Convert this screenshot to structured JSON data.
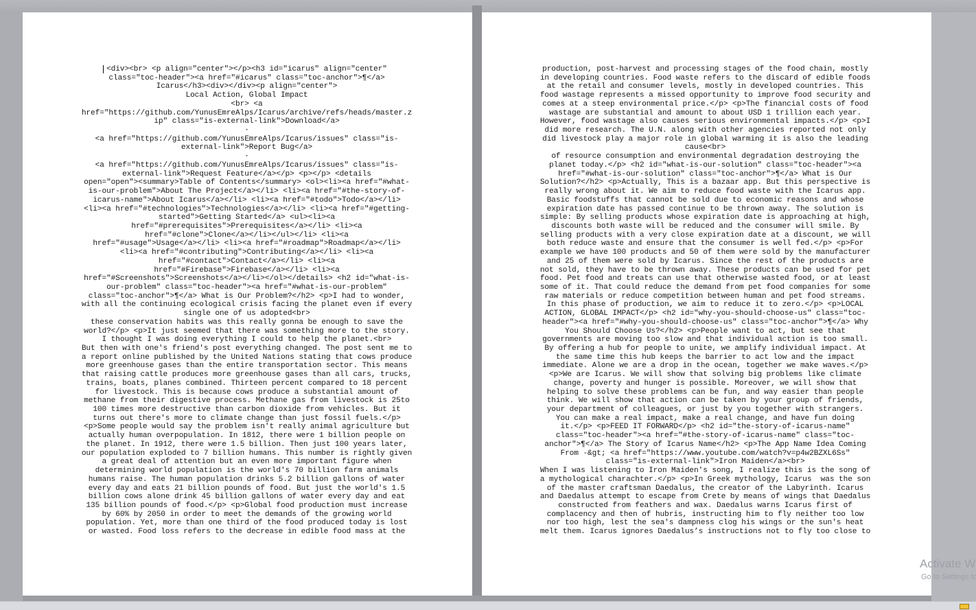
{
  "document": {
    "left_page": {
      "lines": [
        "<div><br> <p align=\"center\"></p><h3 id=\"icarus\" align=\"center\"",
        "class=\"toc-header\"><a href=\"#icarus\" class=\"toc-anchor\">¶</a>",
        "Icarus</h3><div></div><p align=\"center\">",
        "Local Action, Global Impact",
        "<br> <a",
        "href=\"https://github.com/YunusEmreAlps/Icarus/archive/refs/heads/master.z",
        "ip\" class=\"is-external-link\">Download</a>",
        "·",
        "<a href=\"https://github.com/YunusEmreAlps/Icarus/issues\" class=\"is-",
        "external-link\">Report Bug</a>",
        "·",
        "<a href=\"https://github.com/YunusEmreAlps/Icarus/issues\" class=\"is-",
        "external-link\">Request Feature</a></p> <p></p> <details",
        "open=\"open\"><summary>Table of Contents</summary> <ol><li><a href=\"#what-",
        "is-our-problem\">About The Project</a></li> <li><a href=\"#the-story-of-",
        "icarus-name\">About Icarus</a></li> <li><a href=\"#todo\">Todo</a></li>",
        "<li><a href=\"#technologies\">Technologies</a></li> <li><a href=\"#getting-",
        "started\">Getting Started</a> <ul><li><a",
        "href=\"#prerequisites\">Prerequisites</a></li> <li><a",
        "href=\"#clone\">Clone</a></li></ul></li> <li><a",
        "href=\"#usage\">Usage</a></li> <li><a href=\"#roadmap\">Roadmap</a></li>",
        "<li><a href=\"#contributing\">Contributing</a></li> <li><a",
        "href=\"#contact\">Contact</a></li> <li><a",
        "href=\"#Firebase\">Firebase</a></li> <li><a",
        "href=\"#Screenshots\">Screenshots</a></li></ol></details> <h2 id=\"what-is-",
        "our-problem\" class=\"toc-header\"><a href=\"#what-is-our-problem\"",
        "class=\"toc-anchor\">¶</a> What is Our Problem?</h2> <p>I had to wonder,",
        "with all the continuing ecological crisis facing the planet even if every",
        "single one of us adopted<br>",
        "these conservation habits was this really gonna be enough to save the",
        "world?</p> <p>It just seemed that there was something more to the story.",
        "I thought I was doing everything I could to help the planet.<br>",
        "But then with one's friend's post everything changed. The post sent me to",
        "a report online published by the United Nations stating that cows produce",
        "more greenhouse gases than the entire transportation sector. This means",
        "that raising cattle produces more greenhouse gases than all cars, trucks,",
        "trains, boats, planes combined. Thirteen percent compared to 18 percent",
        "for livestock. This is because cows produce a substantial amount of",
        "methane from their digestive process. Methane gas from livestock is 25to",
        "100 times more destructive than carbon dioxide from vehicles. But it",
        "turns out there's more to climate change than just fossil fuels.</p>",
        "<p>Some people would say the problem isn't really animal agriculture but",
        "actually human overpopulation. In 1812, there were 1 billion people on",
        "the planet. In 1912, there were 1.5 billion. Then just 100 years later,",
        "our population exploded to 7 billion humans. This number is rightly given",
        "a great deal of attention but an even more important figure when",
        "determining world population is the world's 70 billion farm animals",
        "humans raise. The human population drinks 5.2 billion gallons of water",
        "every day and eats 21 billion pounds of food. But just the world's 1.5",
        "billion cows alone drink 45 billion gallons of water every day and eat",
        "135 billion pounds of food.</p> <p>Global food production must increase",
        "by 60% by 2050 in order to meet the demands of the growing world",
        "population. Yet, more than one third of the food produced today is lost",
        "or wasted. Food loss refers to the decrease in edible food mass at the"
      ]
    },
    "right_page": {
      "lines": [
        "production, post-harvest and processing stages of the food chain, mostly",
        "in developing countries. Food waste refers to the discard of edible foods",
        "at the retail and consumer levels, mostly in developed countries. This",
        "food wastage represents a missed opportunity to improve food security and",
        "comes at a steep environmental price.</p> <p>The financial costs of food",
        "wastage are substantial and amount to about USD 1 trillion each year.",
        "However, food wastage also causes serious environmental impacts.</p> <p>I",
        "did more research. The U.N. along with other agencies reported not only",
        "did livestock play a major role in global warming it is also the leading",
        "cause<br>",
        "of resource consumption and environmental degradation destroying the",
        "planet today.</p> <h2 id=\"what-is-our-solution\" class=\"toc-header\"><a",
        "href=\"#what-is-our-solution\" class=\"toc-anchor\">¶</a> What is Our",
        "Solution?</h2> <p>Actually, This is a bazaar app. But this perspective is",
        "really wrong about it. We aim to reduce food waste with the Icarus app.",
        "Basic foodstuffs that cannot be sold due to economic reasons and whose",
        "expiration date has passed continue to be thrown away. The solution is",
        "simple: By selling products whose expiration date is approaching at high,",
        "discounts both waste will be reduced and the consumer will smile. By",
        "selling products with a very close expiration date at a discount, we will",
        "both reduce waste and ensure that the consumer is well fed.</p> <p>For",
        "example we have 100 products and 50 of them were sold by the manufacturer",
        "and 25 of them were sold by Icarus. Since the rest of the products are",
        "not sold, they have to be thrown away. These products can be used for pet",
        "food. Pet food and treats can use that otherwise wasted food, or at least",
        "some of it. That could reduce the demand from pet food companies for some",
        "raw materials or reduce competition between human and pet food streams.",
        "In this phase of production, we aim to reduce it to zero.</p> <p>LOCAL",
        "ACTION, GLOBAL IMPACT</p> <h2 id=\"why-you-should-choose-us\" class=\"toc-",
        "header\"><a href=\"#why-you-should-choose-us\" class=\"toc-anchor\">¶</a> Why",
        "You Should Choose Us?</h2> <p>People want to act, but see that",
        "governments are moving too slow and that individual action is too small.",
        "By offering a hub for people to unite, we amplify individual impact. At",
        "the same time this hub keeps the barrier to act low and the impact",
        "immediate. Alone we are a drop in the ocean, together we make waves.</p>",
        "<p>We are Icarus. We will show that solving big problems like climate",
        "change, poverty and hunger is possible. Moreover, we will show that",
        "helping to solve these problems can be fun, and way easier than people",
        "think. We will show that action can be taken by your group of friends,",
        "your department of colleagues, or just by you together with strangers.",
        "You can make a real impact, make a real change, and have fun doing",
        "it.</p> <p>FEED IT FORWARD</p> <h2 id=\"the-story-of-icarus-name\"",
        "class=\"toc-header\"><a href=\"#the-story-of-icarus-name\" class=\"toc-",
        "anchor\">¶</a> The Story of Icarus Name</h2> <p>The App Name Idea Coming",
        "From -&gt; <a href=\"https://www.youtube.com/watch?v=p4w2BZXL6Ss\"",
        "class=\"is-external-link\">Iron Maiden</a><br>",
        "When I was listening to Iron Maiden's song, I realize this is the song of",
        "a mythological charachter.</p> <p>In Greek mythology, Icarus  was the son",
        "of the master craftsman Daedalus, the creator of the Labyrinth. Icarus",
        "and Daedalus attempt to escape from Crete by means of wings that Daedalus",
        "constructed from feathers and wax. Daedalus warns Icarus first of",
        "complacency and then of hubris, instructing him to fly neither too low",
        "nor too high, lest the sea's dampness clog his wings or the sun's heat",
        "melt them. Icarus ignores Daedalus’s instructions not to fly too close to"
      ]
    }
  },
  "watermark": {
    "line1": "Activate Windows",
    "line2": "Go to Settings to activate Windows."
  }
}
